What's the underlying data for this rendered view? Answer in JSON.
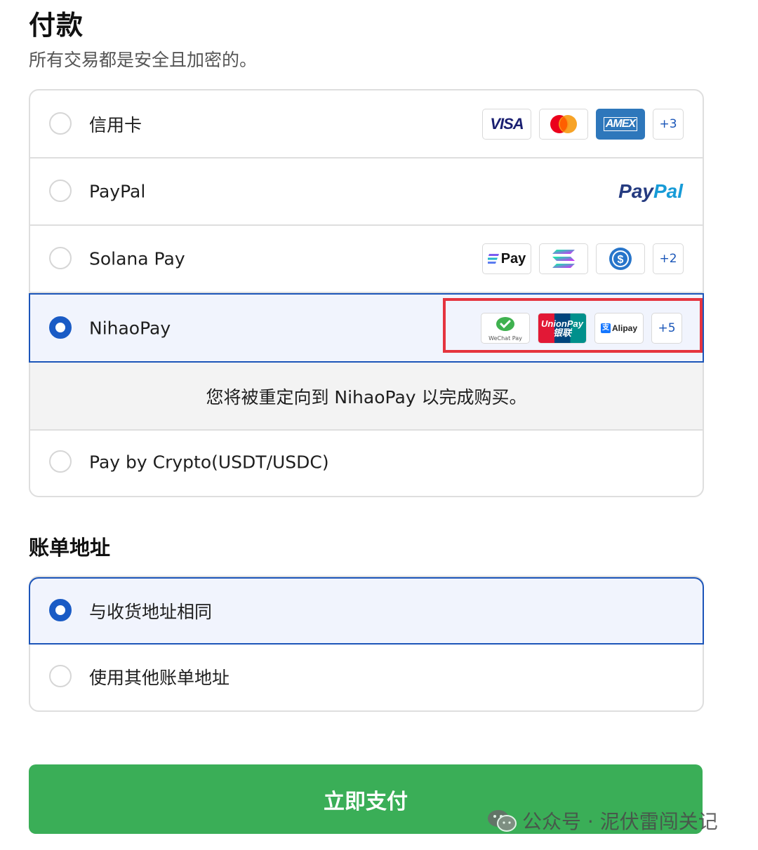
{
  "page": {
    "title": "付款",
    "subtitle": "所有交易都是安全且加密的。"
  },
  "payment_methods": [
    {
      "label": "信用卡",
      "selected": false,
      "logos": [
        "VISA",
        "mastercard",
        "AMEX"
      ],
      "more": "+3"
    },
    {
      "label": "PayPal",
      "selected": false,
      "brand_prefix": "Pay",
      "brand_suffix": "Pal"
    },
    {
      "label": "Solana Pay",
      "selected": false,
      "logos": [
        "Pay",
        "solana",
        "usdc"
      ],
      "more": "+2"
    },
    {
      "label": "NihaoPay",
      "selected": true,
      "logos": [
        "WeChat Pay",
        "UnionPay",
        "银联",
        "Alipay"
      ],
      "more": "+5",
      "redirect_note": "您将被重定向到 NihaoPay 以完成购买。"
    },
    {
      "label": "Pay by Crypto(USDT/USDC)",
      "selected": false
    }
  ],
  "billing": {
    "title": "账单地址",
    "options": [
      {
        "label": "与收货地址相同",
        "selected": true
      },
      {
        "label": "使用其他账单地址",
        "selected": false
      }
    ]
  },
  "submit_label": "立即支付",
  "watermark": "公众号 · 泥伏雷闯关记",
  "colors": {
    "accent": "#1a5bc5",
    "pay_button": "#3aae57",
    "highlight": "#e5343f",
    "selected_bg": "#f1f4fd"
  }
}
